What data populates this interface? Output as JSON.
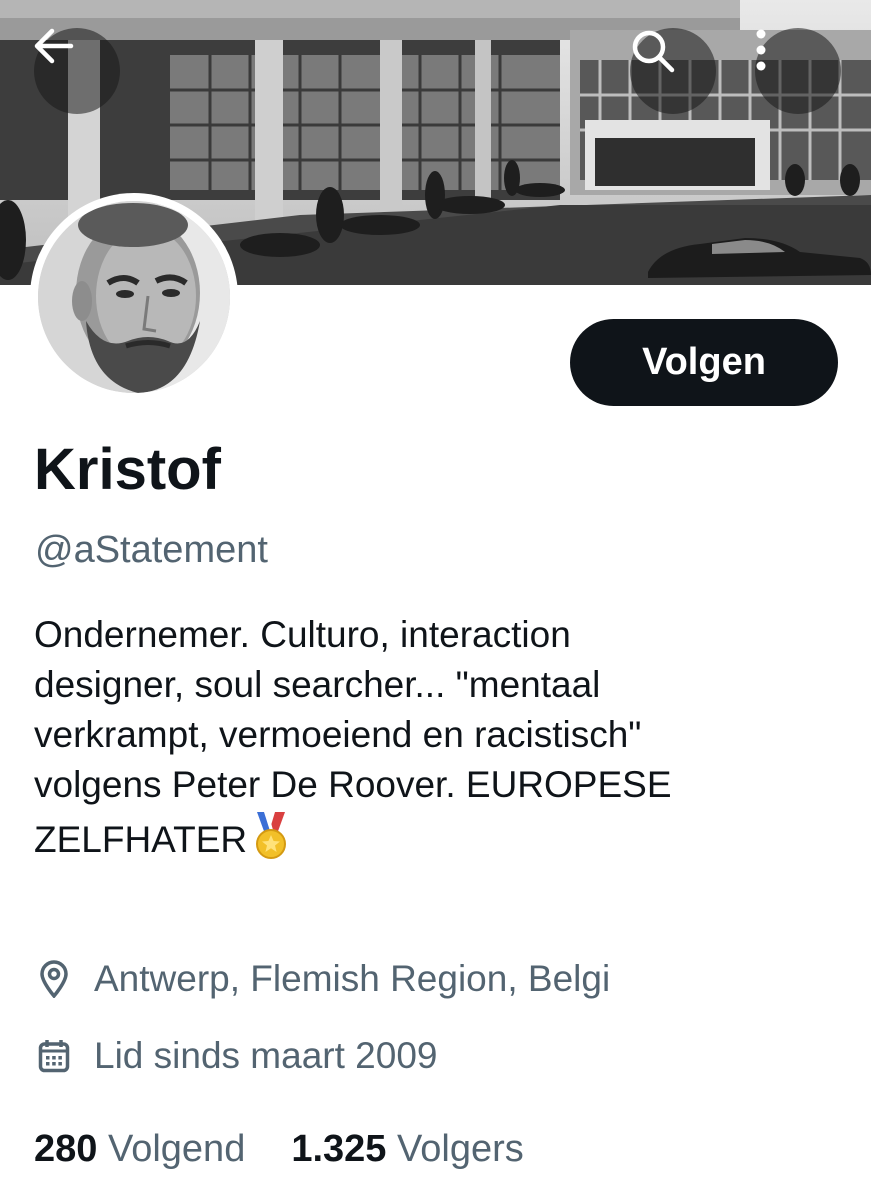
{
  "header": {
    "back_icon": "arrow-left-icon",
    "search_icon": "search-icon",
    "more_icon": "more-vertical-icon"
  },
  "profile": {
    "display_name": "Kristof",
    "handle": "@aStatement",
    "bio_lines": [
      "Ondernemer. Culturo, interaction",
      "designer, soul searcher... \"mentaal",
      "verkrampt, vermoeiend en racistisch\"",
      "volgens Peter De Roover. EUROPESE",
      "ZELFHATER"
    ],
    "bio_emoji": "medal-icon",
    "location": "Antwerp, Flemish Region, Belgi",
    "joined": "Lid sinds maart 2009"
  },
  "actions": {
    "follow_label": "Volgen"
  },
  "stats": {
    "following_count": "280",
    "following_label": "Volgend",
    "followers_count": "1.325",
    "followers_label": "Volgers"
  },
  "colors": {
    "primary_text": "#0f1419",
    "secondary_text": "#536471",
    "button_bg": "#0f1419"
  }
}
